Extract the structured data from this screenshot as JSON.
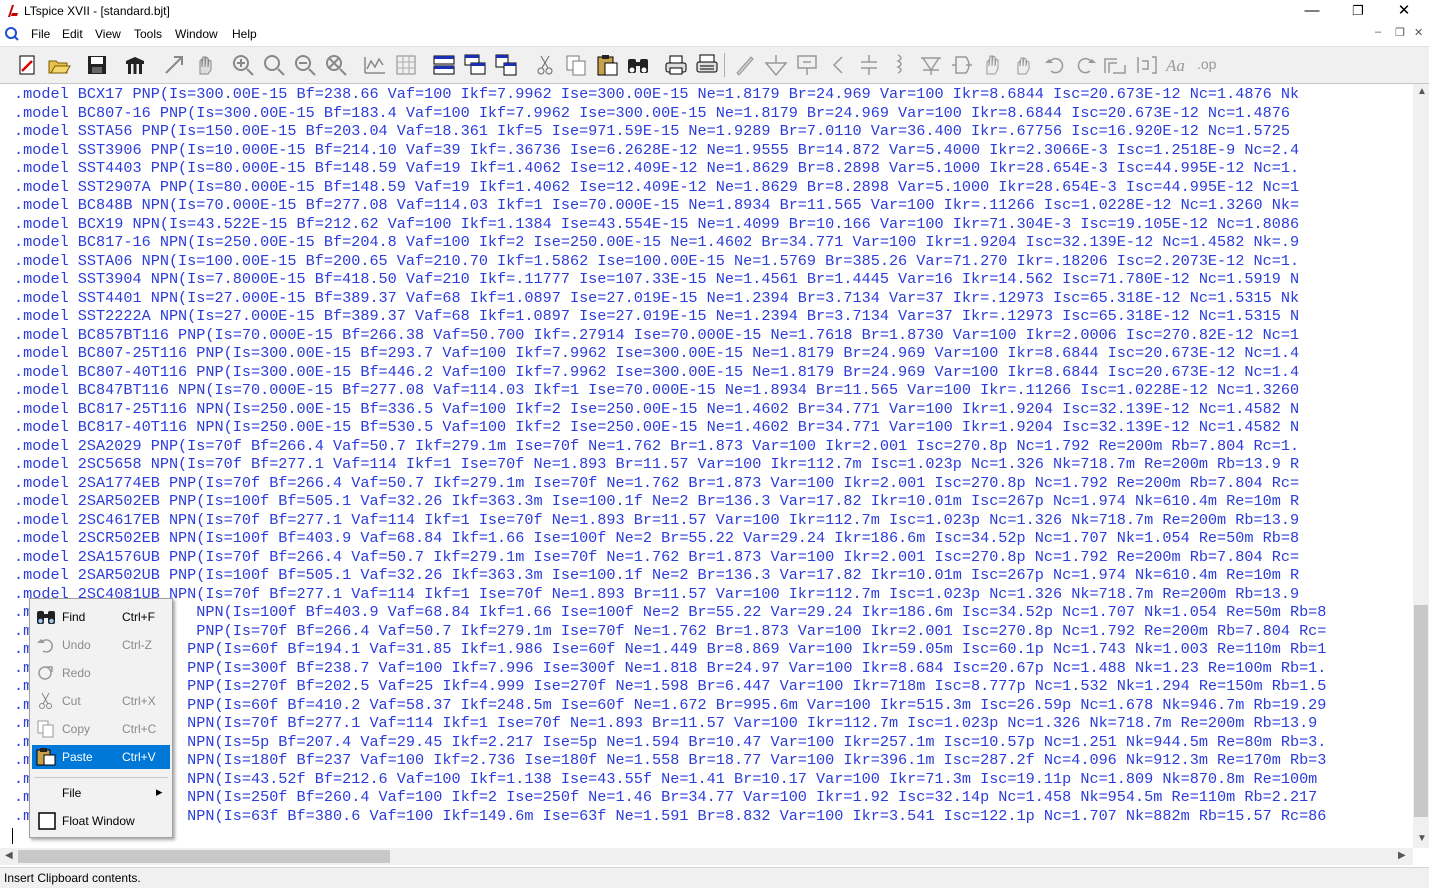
{
  "window": {
    "title": "LTspice XVII - [standard.bjt]",
    "minimize": "—",
    "restore": "❐",
    "close": "✕"
  },
  "menu": [
    "File",
    "Edit",
    "View",
    "Tools",
    "Window",
    "Help"
  ],
  "mdi": {
    "minimize": "–",
    "restore": "❐",
    "close": "✕"
  },
  "toolbar_icons": [
    "new-schematic-icon",
    "open-icon",
    "save-icon",
    "control-panel-icon",
    "run-icon",
    "halt-icon",
    "zoom-in-icon",
    "zoom-pan-icon",
    "zoom-out-icon",
    "zoom-fit-icon",
    "autorange-icon",
    "grid-icon",
    "tile-horizontal-icon",
    "cascade-icon",
    "tile-vertical-icon",
    "cut-icon",
    "copy-icon",
    "paste-icon",
    "find-icon",
    "print-icon",
    "print-setup-icon",
    "wire-icon",
    "ground-icon",
    "label-net-icon",
    "resistor-icon",
    "capacitor-icon",
    "inductor-icon",
    "diode-icon",
    "component-icon",
    "move-icon",
    "drag-icon",
    "undo-icon",
    "redo-icon",
    "rotate-icon",
    "mirror-icon",
    "text-icon",
    "spice-directive-icon"
  ],
  "editor": {
    "lines": [
      ".model BCX17 PNP(Is=300.00E-15 Bf=238.66 Vaf=100 Ikf=7.9962 Ise=300.00E-15 Ne=1.8179 Br=24.969 Var=100 Ikr=8.6844 Isc=20.673E-12 Nc=1.4876 Nk",
      ".model BC807-16 PNP(Is=300.00E-15 Bf=183.4 Vaf=100 Ikf=7.9962 Ise=300.00E-15 Ne=1.8179 Br=24.969 Var=100 Ikr=8.6844 Isc=20.673E-12 Nc=1.4876",
      ".model SSTA56 PNP(Is=150.00E-15 Bf=203.04 Vaf=18.361 Ikf=5 Ise=971.59E-15 Ne=1.9289 Br=7.0110 Var=36.400 Ikr=.67756 Isc=16.920E-12 Nc=1.5725",
      ".model SST3906 PNP(Is=10.000E-15 Bf=214.10 Vaf=39 Ikf=.36736 Ise=6.2628E-12 Ne=1.9555 Br=14.872 Var=5.4000 Ikr=2.3066E-3 Isc=1.2518E-9 Nc=2.4",
      ".model SST4403 PNP(Is=80.000E-15 Bf=148.59 Vaf=19 Ikf=1.4062 Ise=12.409E-12 Ne=1.8629 Br=8.2898 Var=5.1000 Ikr=28.654E-3 Isc=44.995E-12 Nc=1.",
      ".model SST2907A PNP(Is=80.000E-15 Bf=148.59 Vaf=19 Ikf=1.4062 Ise=12.409E-12 Ne=1.8629 Br=8.2898 Var=5.1000 Ikr=28.654E-3 Isc=44.995E-12 Nc=1",
      ".model BC848B NPN(Is=70.000E-15 Bf=277.08 Vaf=114.03 Ikf=1 Ise=70.000E-15 Ne=1.8934 Br=11.565 Var=100 Ikr=.11266 Isc=1.0228E-12 Nc=1.3260 Nk=",
      ".model BCX19 NPN(Is=43.522E-15 Bf=212.62 Vaf=100 Ikf=1.1384 Ise=43.554E-15 Ne=1.4099 Br=10.166 Var=100 Ikr=71.304E-3 Isc=19.105E-12 Nc=1.8086",
      ".model BC817-16 NPN(Is=250.00E-15 Bf=204.8 Vaf=100 Ikf=2 Ise=250.00E-15 Ne=1.4602 Br=34.771 Var=100 Ikr=1.9204 Isc=32.139E-12 Nc=1.4582 Nk=.9",
      ".model SSTA06 NPN(Is=100.00E-15 Bf=200.65 Vaf=210.70 Ikf=1.5862 Ise=100.00E-15 Ne=1.5769 Br=385.26 Var=71.270 Ikr=.18206 Isc=2.2073E-12 Nc=1.",
      ".model SST3904 NPN(Is=7.8000E-15 Bf=418.50 Vaf=210 Ikf=.11777 Ise=107.33E-15 Ne=1.4561 Br=1.4445 Var=16 Ikr=14.562 Isc=71.780E-12 Nc=1.5919 N",
      ".model SST4401 NPN(Is=27.000E-15 Bf=389.37 Vaf=68 Ikf=1.0897 Ise=27.019E-15 Ne=1.2394 Br=3.7134 Var=37 Ikr=.12973 Isc=65.318E-12 Nc=1.5315 Nk",
      ".model SST2222A NPN(Is=27.000E-15 Bf=389.37 Vaf=68 Ikf=1.0897 Ise=27.019E-15 Ne=1.2394 Br=3.7134 Var=37 Ikr=.12973 Isc=65.318E-12 Nc=1.5315 N",
      ".model BC857BT116 PNP(Is=70.000E-15 Bf=266.38 Vaf=50.700 Ikf=.27914 Ise=70.000E-15 Ne=1.7618 Br=1.8730 Var=100 Ikr=2.0006 Isc=270.82E-12 Nc=1",
      ".model BC807-25T116 PNP(Is=300.00E-15 Bf=293.7 Vaf=100 Ikf=7.9962 Ise=300.00E-15 Ne=1.8179 Br=24.969 Var=100 Ikr=8.6844 Isc=20.673E-12 Nc=1.4",
      ".model BC807-40T116 PNP(Is=300.00E-15 Bf=446.2 Vaf=100 Ikf=7.9962 Ise=300.00E-15 Ne=1.8179 Br=24.969 Var=100 Ikr=8.6844 Isc=20.673E-12 Nc=1.4",
      ".model BC847BT116 NPN(Is=70.000E-15 Bf=277.08 Vaf=114.03 Ikf=1 Ise=70.000E-15 Ne=1.8934 Br=11.565 Var=100 Ikr=.11266 Isc=1.0228E-12 Nc=1.3260",
      ".model BC817-25T116 NPN(Is=250.00E-15 Bf=336.5 Vaf=100 Ikf=2 Ise=250.00E-15 Ne=1.4602 Br=34.771 Var=100 Ikr=1.9204 Isc=32.139E-12 Nc=1.4582 N",
      ".model BC817-40T116 NPN(Is=250.00E-15 Bf=530.5 Vaf=100 Ikf=2 Ise=250.00E-15 Ne=1.4602 Br=34.771 Var=100 Ikr=1.9204 Isc=32.139E-12 Nc=1.4582 N",
      ".model 2SA2029 PNP(Is=70f Bf=266.4 Vaf=50.7 Ikf=279.1m Ise=70f Ne=1.762 Br=1.873 Var=100 Ikr=2.001 Isc=270.8p Nc=1.792 Re=200m Rb=7.804 Rc=1.",
      ".model 2SC5658 NPN(Is=70f Bf=277.1 Vaf=114 Ikf=1 Ise=70f Ne=1.893 Br=11.57 Var=100 Ikr=112.7m Isc=1.023p Nc=1.326 Nk=718.7m Re=200m Rb=13.9 R",
      ".model 2SA1774EB PNP(Is=70f Bf=266.4 Vaf=50.7 Ikf=279.1m Ise=70f Ne=1.762 Br=1.873 Var=100 Ikr=2.001 Isc=270.8p Nc=1.792 Re=200m Rb=7.804 Rc=",
      ".model 2SAR502EB PNP(Is=100f Bf=505.1 Vaf=32.26 Ikf=363.3m Ise=100.1f Ne=2 Br=136.3 Var=17.82 Ikr=10.01m Isc=267p Nc=1.974 Nk=610.4m Re=10m R",
      ".model 2SC4617EB NPN(Is=70f Bf=277.1 Vaf=114 Ikf=1 Ise=70f Ne=1.893 Br=11.57 Var=100 Ikr=112.7m Isc=1.023p Nc=1.326 Nk=718.7m Re=200m Rb=13.9",
      ".model 2SCR502EB NPN(Is=100f Bf=403.9 Vaf=68.84 Ikf=1.66 Ise=100f Ne=2 Br=55.22 Var=29.24 Ikr=186.6m Isc=34.52p Nc=1.707 Nk=1.054 Re=50m Rb=8",
      ".model 2SA1576UB PNP(Is=70f Bf=266.4 Vaf=50.7 Ikf=279.1m Ise=70f Ne=1.762 Br=1.873 Var=100 Ikr=2.001 Isc=270.8p Nc=1.792 Re=200m Rb=7.804 Rc=",
      ".model 2SAR502UB PNP(Is=100f Bf=505.1 Vaf=32.26 Ikf=363.3m Ise=100.1f Ne=2 Br=136.3 Var=17.82 Ikr=10.01m Isc=267p Nc=1.974 Nk=610.4m Re=10m R",
      ".model 2SC4081UB NPN(Is=70f Bf=277.1 Vaf=114 Ikf=1 Ise=70f Ne=1.893 Br=11.57 Var=100 Ikr=112.7m Isc=1.023p Nc=1.326 Nk=718.7m Re=200m Rb=13.9",
      ".m                  NPN(Is=100f Bf=403.9 Vaf=68.84 Ikf=1.66 Ise=100f Ne=2 Br=55.22 Var=29.24 Ikr=186.6m Isc=34.52p Nc=1.707 Nk=1.054 Re=50m Rb=8",
      ".m                  PNP(Is=70f Bf=266.4 Vaf=50.7 Ikf=279.1m Ise=70f Ne=1.762 Br=1.873 Var=100 Ikr=2.001 Isc=270.8p Nc=1.792 Re=200m Rb=7.804 Rc=",
      ".m                 PNP(Is=60f Bf=194.1 Vaf=31.85 Ikf=1.986 Ise=60f Ne=1.449 Br=8.869 Var=100 Ikr=59.05m Isc=60.1p Nc=1.743 Nk=1.003 Re=110m Rb=1",
      ".m                 PNP(Is=300f Bf=238.7 Vaf=100 Ikf=7.996 Ise=300f Ne=1.818 Br=24.97 Var=100 Ikr=8.684 Isc=20.67p Nc=1.488 Nk=1.23 Re=100m Rb=1.",
      ".m                 PNP(Is=270f Bf=202.5 Vaf=25 Ikf=4.999 Ise=270f Ne=1.598 Br=6.447 Var=100 Ikr=718m Isc=8.777p Nc=1.532 Nk=1.294 Re=150m Rb=1.5",
      ".m                 PNP(Is=60f Bf=410.2 Vaf=58.37 Ikf=248.5m Ise=60f Ne=1.672 Br=995.6m Var=100 Ikr=515.3m Isc=26.59p Nc=1.678 Nk=946.7m Rb=19.29",
      ".m                 NPN(Is=70f Bf=277.1 Vaf=114 Ikf=1 Ise=70f Ne=1.893 Br=11.57 Var=100 Ikr=112.7m Isc=1.023p Nc=1.326 Nk=718.7m Re=200m Rb=13.9",
      ".m                 NPN(Is=5p Bf=207.4 Vaf=29.45 Ikf=2.217 Ise=5p Ne=1.594 Br=10.47 Var=100 Ikr=257.1m Isc=10.57p Nc=1.251 Nk=944.5m Re=80m Rb=3.",
      ".m                 NPN(Is=180f Bf=237 Vaf=100 Ikf=2.736 Ise=180f Ne=1.558 Br=18.77 Var=100 Ikr=396.1m Isc=287.2f Nc=4.096 Nk=912.3m Re=170m Rb=3",
      ".m                 NPN(Is=43.52f Bf=212.6 Vaf=100 Ikf=1.138 Ise=43.55f Ne=1.41 Br=10.17 Var=100 Ikr=71.3m Isc=19.11p Nc=1.809 Nk=870.8m Re=100m",
      ".m                 NPN(Is=250f Bf=260.4 Vaf=100 Ikf=2 Ise=250f Ne=1.46 Br=34.77 Var=100 Ikr=1.92 Isc=32.14p Nc=1.458 Nk=954.5m Re=110m Rb=2.217",
      ".m                 NPN(Is=63f Bf=380.6 Vaf=100 Ikf=149.6m Ise=63f Ne=1.591 Br=8.832 Var=100 Ikr=3.541 Isc=122.1p Nc=1.707 Nk=882m Rb=15.57 Rc=86"
    ]
  },
  "context_menu": {
    "items": [
      {
        "label": "Find",
        "shortcut": "Ctrl+F",
        "icon": "binoculars-icon",
        "enabled": true
      },
      {
        "label": "Undo",
        "shortcut": "Ctrl-Z",
        "icon": "undo-icon",
        "enabled": false
      },
      {
        "label": "Redo",
        "shortcut": "",
        "icon": "redo-icon",
        "enabled": false
      },
      {
        "label": "Cut",
        "shortcut": "Ctrl+X",
        "icon": "scissors-icon",
        "enabled": false
      },
      {
        "label": "Copy",
        "shortcut": "Ctrl+C",
        "icon": "copy-icon",
        "enabled": false
      },
      {
        "label": "Paste",
        "shortcut": "Ctrl+V",
        "icon": "clipboard-icon",
        "enabled": true,
        "highlighted": true
      },
      {
        "label": "File",
        "shortcut": "",
        "icon": "",
        "enabled": true,
        "submenu_arrow": "▸"
      },
      {
        "label": "Float Window",
        "shortcut": "",
        "icon": "checkbox-icon",
        "enabled": true
      }
    ]
  },
  "statusbar": {
    "text": "Insert Clipboard contents."
  },
  "colors": {
    "text_blue": "#2b3cdb",
    "highlight": "#0078d7",
    "menu_bg": "#f2f2f2"
  }
}
